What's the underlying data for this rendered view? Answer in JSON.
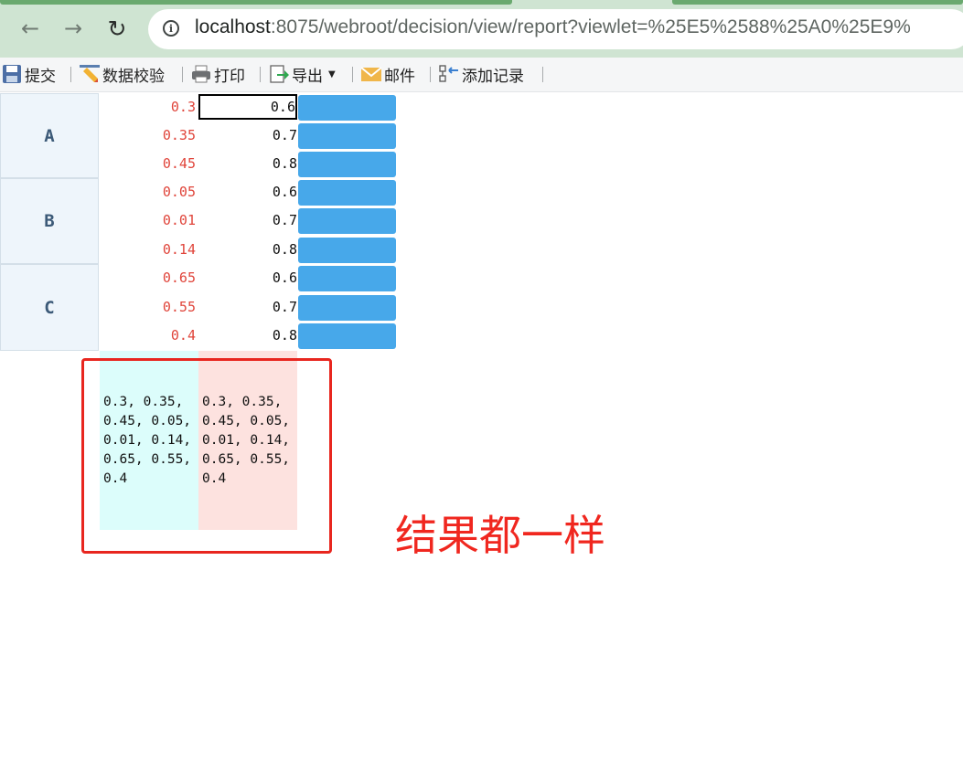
{
  "browser": {
    "back_icon": "arrow-left-icon",
    "forward_icon": "arrow-right-icon",
    "reload_icon": "reload-icon",
    "info_icon": "info-icon",
    "url_host": "localhost",
    "url_rest": ":8075/webroot/decision/view/report?viewlet=%25E5%2588%25A0%25E9%"
  },
  "toolbar": {
    "submit": "提交",
    "validate": "数据校验",
    "print": "打印",
    "export": "导出",
    "mail": "邮件",
    "add_record": "添加记录"
  },
  "report": {
    "groups": [
      {
        "label": "A",
        "rows": [
          {
            "v1": "0.3",
            "v2": "0.6"
          },
          {
            "v1": "0.35",
            "v2": "0.7"
          },
          {
            "v1": "0.45",
            "v2": "0.8"
          }
        ]
      },
      {
        "label": "B",
        "rows": [
          {
            "v1": "0.05",
            "v2": "0.6"
          },
          {
            "v1": "0.01",
            "v2": "0.7"
          },
          {
            "v1": "0.14",
            "v2": "0.8"
          }
        ]
      },
      {
        "label": "C",
        "rows": [
          {
            "v1": "0.65",
            "v2": "0.6"
          },
          {
            "v1": "0.55",
            "v2": "0.7"
          },
          {
            "v1": "0.4",
            "v2": "0.8"
          }
        ]
      }
    ],
    "result_cyan": "0.3,0.35,0.45,0.05,0.01,0.14,0.65,0.55,0.4",
    "result_pink": "0.3,0.35,0.45,0.05,0.01,0.14,0.65,0.55,0.4"
  },
  "annotation": {
    "text": "结果都一样",
    "color": "#f0271f"
  },
  "colors": {
    "button_blue": "#47a8ea",
    "value_red": "#e0453b"
  }
}
